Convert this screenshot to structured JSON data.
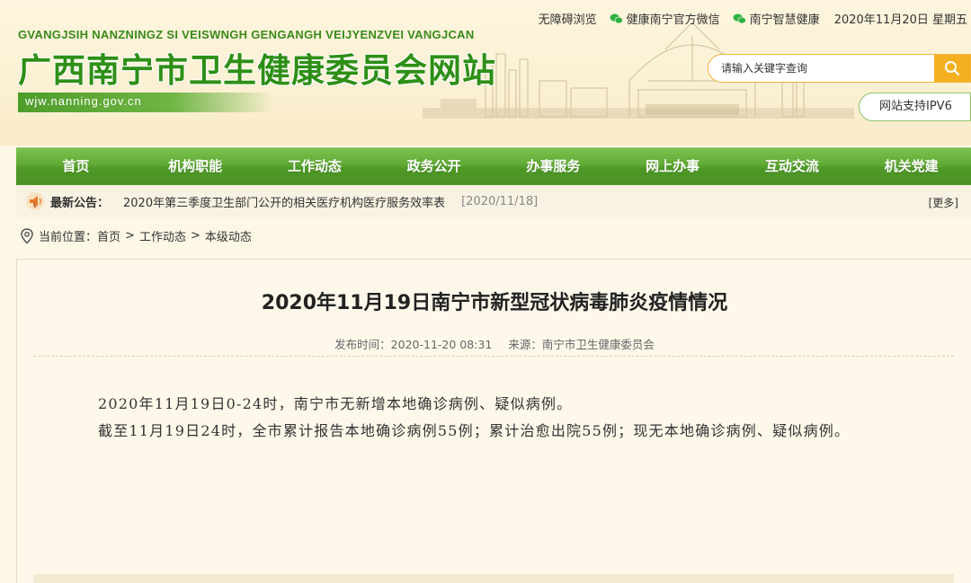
{
  "topbar": {
    "accessibility": "无障碍浏览",
    "wechat_official": "健康南宁官方微信",
    "wechat_smart": "南宁智慧健康",
    "date": "2020年11月20日 星期五"
  },
  "header": {
    "pinyin": "GVANGJSIH NANZNINGZ SI VEISWNGH GENGANGH VEIJYENZVEI VANGJCAN",
    "title": "广西南宁市卫生健康委员会网站",
    "domain": "wjw.nanning.gov.cn",
    "search_placeholder": "请输入关键字查询",
    "ipv6": "网站支持IPV6"
  },
  "nav": {
    "items": [
      "首页",
      "机构职能",
      "工作动态",
      "政务公开",
      "办事服务",
      "网上办事",
      "互动交流",
      "机关党建"
    ]
  },
  "notice": {
    "label": "最新公告：",
    "text": "2020年第三季度卫生部门公开的相关医疗机构医疗服务效率表",
    "date": "[2020/11/18]",
    "more": "[更多]"
  },
  "breadcrumb": {
    "prefix": "当前位置：",
    "items": [
      "首页",
      "工作动态",
      "本级动态"
    ],
    "separator": ">"
  },
  "article": {
    "title": "2020年11月19日南宁市新型冠状病毒肺炎疫情情况",
    "published_label": "发布时间：",
    "published": "2020-11-20 08:31",
    "source_label": "来源：",
    "source": "南宁市卫生健康委员会",
    "paragraphs": [
      "2020年11月19日0-24时，南宁市无新增本地确诊病例、疑似病例。",
      "截至11月19日24时，全市累计报告本地确诊病例55例；累计治愈出院55例；现无本地确诊病例、疑似病例。"
    ]
  },
  "colors": {
    "brand_green": "#2e8f16",
    "nav_green": "#5fa934",
    "search_accent": "#f5b01f",
    "page_bg": "#fdf7e6"
  },
  "icons": [
    "wechat-icon",
    "search-icon",
    "horn-icon",
    "location-pin-icon"
  ]
}
